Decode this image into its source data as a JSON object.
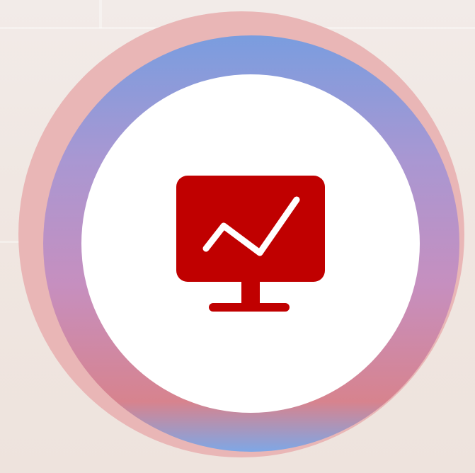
{
  "icon": {
    "name": "monitor-chart-icon",
    "color": "#c00000"
  },
  "colors": {
    "outer_ring": "#e9b6b6",
    "gradient_top": "#7a9ddf",
    "gradient_bottom": "#d7838e",
    "inner_disc": "#ffffff",
    "background": "#f2ebe8"
  }
}
